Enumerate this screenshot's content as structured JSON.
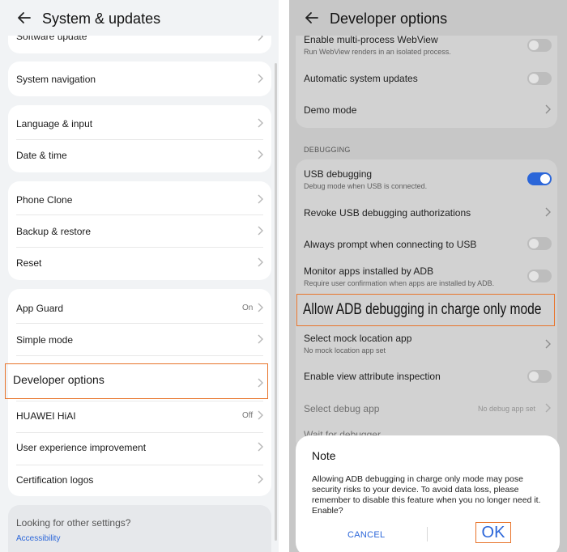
{
  "left": {
    "title": "System & updates",
    "partial_item": "Software update",
    "items": {
      "system_navigation": "System navigation",
      "language_input": "Language & input",
      "date_time": "Date & time",
      "phone_clone": "Phone Clone",
      "backup_restore": "Backup & restore",
      "reset": "Reset",
      "app_guard": "App Guard",
      "app_guard_value": "On",
      "simple_mode": "Simple mode",
      "developer_options": "Developer options",
      "huawei_hiai": "HUAWEI HiAI",
      "huawei_hiai_value": "Off",
      "user_experience": "User experience improvement",
      "certification_logos": "Certification logos"
    },
    "footer": {
      "question": "Looking for other settings?",
      "link": "Accessibility"
    }
  },
  "right": {
    "title": "Developer options",
    "items": {
      "multiprocess_webview": "Enable multi-process WebView",
      "multiprocess_webview_sub": "Run WebView renders in an isolated process.",
      "auto_updates": "Automatic system updates",
      "demo_mode": "Demo mode",
      "section_debugging": "DEBUGGING",
      "usb_debugging": "USB debugging",
      "usb_debugging_sub": "Debug mode when USB is connected.",
      "revoke_usb": "Revoke USB debugging authorizations",
      "always_prompt": "Always prompt when connecting to USB",
      "monitor_apps": "Monitor apps installed by ADB",
      "monitor_apps_sub": "Require user confirmation when apps are installed by ADB.",
      "allow_adb_charge": "Allow ADB debugging in charge only mode",
      "mock_location": "Select mock location app",
      "mock_location_sub": "No mock location app set",
      "view_attribute": "Enable view attribute inspection",
      "debug_app": "Select debug app",
      "debug_app_value": "No debug app set",
      "wait_debugger": "Wait for debugger"
    },
    "toggles": {
      "multiprocess_webview": false,
      "auto_updates": false,
      "usb_debugging": true,
      "always_prompt": false,
      "monitor_apps": false,
      "view_attribute": false
    },
    "dialog": {
      "title": "Note",
      "body": "Allowing ADB debugging in charge only mode may pose security risks to your device. To avoid data loss, please remember to disable this feature when you no longer need it. Enable?",
      "cancel": "CANCEL",
      "ok": "OK"
    }
  },
  "colors": {
    "accent": "#2b66d9",
    "highlight": "#e8742a"
  },
  "icons": {
    "back": "arrow-left-icon",
    "chevron": "chevron-right-icon"
  }
}
